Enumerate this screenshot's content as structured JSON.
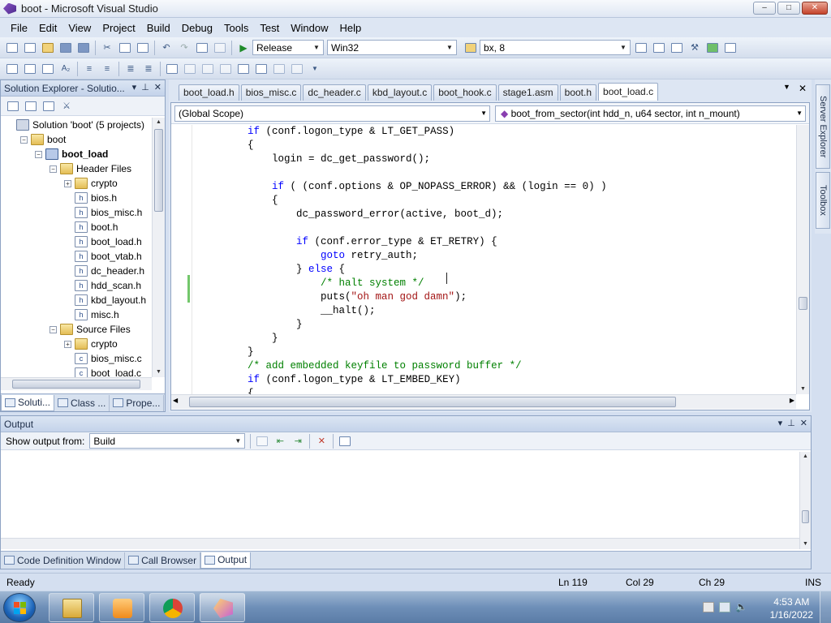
{
  "window": {
    "title": "boot - Microsoft Visual Studio"
  },
  "menu": [
    "File",
    "Edit",
    "View",
    "Project",
    "Build",
    "Debug",
    "Tools",
    "Test",
    "Window",
    "Help"
  ],
  "toolbar": {
    "config": "Release",
    "platform": "Win32",
    "find_value": "bx, 8"
  },
  "solution_explorer": {
    "title": "Solution Explorer - Solutio...",
    "tree": [
      {
        "label": "Solution 'boot' (5 projects)",
        "level": 0,
        "icon": "solution-icon",
        "exp": ""
      },
      {
        "label": "boot",
        "level": 1,
        "icon": "folder-icon",
        "exp": "-"
      },
      {
        "label": "boot_load",
        "level": 2,
        "icon": "project-icon",
        "exp": "-",
        "bold": true
      },
      {
        "label": "Header Files",
        "level": 3,
        "icon": "folder-icon",
        "exp": "-"
      },
      {
        "label": "crypto",
        "level": 4,
        "icon": "folder-icon",
        "exp": "+"
      },
      {
        "label": "bios.h",
        "level": 4,
        "icon": "header-file-icon",
        "exp": ""
      },
      {
        "label": "bios_misc.h",
        "level": 4,
        "icon": "header-file-icon",
        "exp": ""
      },
      {
        "label": "boot.h",
        "level": 4,
        "icon": "header-file-icon",
        "exp": ""
      },
      {
        "label": "boot_load.h",
        "level": 4,
        "icon": "header-file-icon",
        "exp": ""
      },
      {
        "label": "boot_vtab.h",
        "level": 4,
        "icon": "header-file-icon",
        "exp": ""
      },
      {
        "label": "dc_header.h",
        "level": 4,
        "icon": "header-file-icon",
        "exp": ""
      },
      {
        "label": "hdd_scan.h",
        "level": 4,
        "icon": "header-file-icon",
        "exp": ""
      },
      {
        "label": "kbd_layout.h",
        "level": 4,
        "icon": "header-file-icon",
        "exp": ""
      },
      {
        "label": "misc.h",
        "level": 4,
        "icon": "header-file-icon",
        "exp": ""
      },
      {
        "label": "Source Files",
        "level": 3,
        "icon": "folder-icon",
        "exp": "-"
      },
      {
        "label": "crypto",
        "level": 4,
        "icon": "folder-icon",
        "exp": "+"
      },
      {
        "label": "bios_misc.c",
        "level": 4,
        "icon": "c-file-icon",
        "exp": ""
      },
      {
        "label": "boot_load.c",
        "level": 4,
        "icon": "c-file-icon",
        "exp": ""
      }
    ],
    "bottom_tabs": [
      "Soluti...",
      "Class ...",
      "Prope..."
    ]
  },
  "editor": {
    "tabs": [
      "boot_load.h",
      "bios_misc.c",
      "dc_header.c",
      "kbd_layout.c",
      "boot_hook.c",
      "stage1.asm",
      "boot.h",
      "boot_load.c"
    ],
    "active_tab": "boot_load.c",
    "scope": "(Global Scope)",
    "function": "boot_from_sector(int hdd_n, u64 sector, int n_mount)",
    "code": [
      [
        {
          "t": "        "
        },
        {
          "t": "if",
          "c": "kw"
        },
        {
          "t": " (conf.logon_type & LT_GET_PASS)"
        }
      ],
      [
        {
          "t": "        {"
        }
      ],
      [
        {
          "t": "            login = dc_get_password();"
        }
      ],
      [
        {
          "t": ""
        }
      ],
      [
        {
          "t": "            "
        },
        {
          "t": "if",
          "c": "kw"
        },
        {
          "t": " ( (conf.options & OP_NOPASS_ERROR) && (login == 0) )"
        }
      ],
      [
        {
          "t": "            {"
        }
      ],
      [
        {
          "t": "                dc_password_error(active, boot_d);"
        }
      ],
      [
        {
          "t": ""
        }
      ],
      [
        {
          "t": "                "
        },
        {
          "t": "if",
          "c": "kw"
        },
        {
          "t": " (conf.error_type & ET_RETRY) {"
        }
      ],
      [
        {
          "t": "                    "
        },
        {
          "t": "goto",
          "c": "kw"
        },
        {
          "t": " retry_auth;"
        }
      ],
      [
        {
          "t": "                } "
        },
        {
          "t": "else",
          "c": "kw"
        },
        {
          "t": " {"
        }
      ],
      [
        {
          "t": "                    "
        },
        {
          "t": "/* halt system */",
          "c": "cm"
        }
      ],
      [
        {
          "t": "                    puts("
        },
        {
          "t": "\"oh man god damn\"",
          "c": "st"
        },
        {
          "t": ");"
        }
      ],
      [
        {
          "t": "                    __halt();"
        }
      ],
      [
        {
          "t": "                }"
        }
      ],
      [
        {
          "t": "            }"
        }
      ],
      [
        {
          "t": "        }"
        }
      ],
      [
        {
          "t": "        "
        },
        {
          "t": "/* add embedded keyfile to password buffer */",
          "c": "cm"
        }
      ],
      [
        {
          "t": "        "
        },
        {
          "t": "if",
          "c": "kw"
        },
        {
          "t": " (conf.logon_type & LT_EMBED_KEY)"
        }
      ],
      [
        {
          "t": "        {"
        }
      ]
    ]
  },
  "side_tabs": [
    "Server Explorer",
    "Toolbox"
  ],
  "output": {
    "title": "Output",
    "show_from_label": "Show output from:",
    "show_from_value": "Build",
    "bottom_tabs": [
      "Code Definition Window",
      "Call Browser",
      "Output"
    ]
  },
  "status": {
    "text": "Ready",
    "ln": "Ln 119",
    "col": "Col 29",
    "ch": "Ch 29",
    "mode": "INS"
  },
  "taskbar": {
    "time": "4:53 AM",
    "date": "1/16/2022"
  }
}
